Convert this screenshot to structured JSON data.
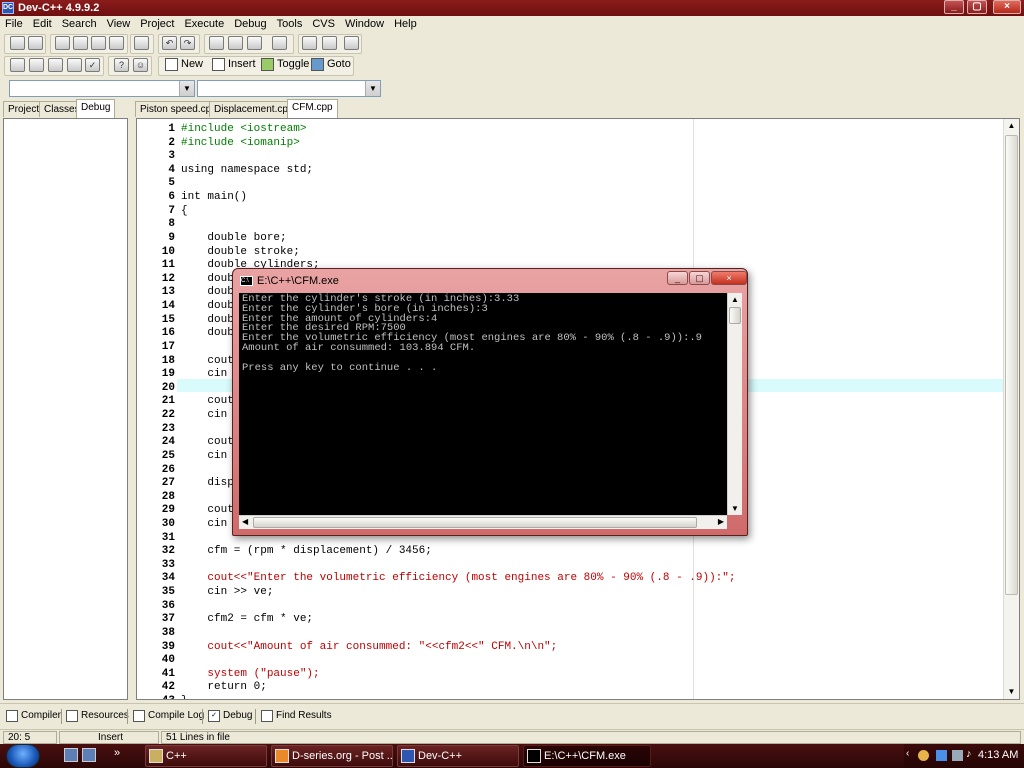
{
  "window": {
    "title": "Dev-C++ 4.9.9.2",
    "app_icon_text": "DC",
    "controls": [
      "_",
      "▢",
      "×"
    ]
  },
  "menubar": {
    "items": [
      "File",
      "Edit",
      "Search",
      "View",
      "Project",
      "Execute",
      "Debug",
      "Tools",
      "CVS",
      "Window",
      "Help"
    ]
  },
  "toolbar2": {
    "new_label": "New",
    "insert_label": "Insert",
    "toggle_label": "Toggle",
    "goto_label": "Goto"
  },
  "left_tabs": [
    "Project",
    "Classes",
    "Debug"
  ],
  "file_tabs": [
    "Piston speed.cpp",
    "Displacement.cpp",
    "CFM.cpp"
  ],
  "active_file_tab": "CFM.cpp",
  "editor": {
    "highlighted_line": "20",
    "lines": [
      {
        "n": "1",
        "text": "#include <iostream>",
        "kind": "pp"
      },
      {
        "n": "2",
        "text": "#include <iomanip>",
        "kind": "pp"
      },
      {
        "n": "3",
        "text": "",
        "kind": "plain"
      },
      {
        "n": "4",
        "text": "using namespace std;",
        "kind": "plain"
      },
      {
        "n": "5",
        "text": "",
        "kind": "plain"
      },
      {
        "n": "6",
        "text": "int main()",
        "kind": "plain"
      },
      {
        "n": "7",
        "text": "{",
        "kind": "plain"
      },
      {
        "n": "8",
        "text": "",
        "kind": "plain"
      },
      {
        "n": "9",
        "text": "    double bore;",
        "kind": "plain"
      },
      {
        "n": "10",
        "text": "    double stroke;",
        "kind": "plain"
      },
      {
        "n": "11",
        "text": "    double cylinders;",
        "kind": "plain"
      },
      {
        "n": "12",
        "text": "    doub",
        "kind": "plain"
      },
      {
        "n": "13",
        "text": "    doub",
        "kind": "plain"
      },
      {
        "n": "14",
        "text": "    doub",
        "kind": "plain"
      },
      {
        "n": "15",
        "text": "    doub",
        "kind": "plain"
      },
      {
        "n": "16",
        "text": "    doub",
        "kind": "plain"
      },
      {
        "n": "17",
        "text": "",
        "kind": "plain"
      },
      {
        "n": "18",
        "text": "    cout",
        "kind": "plain"
      },
      {
        "n": "19",
        "text": "    cin",
        "kind": "plain"
      },
      {
        "n": "20",
        "text": "",
        "kind": "plain"
      },
      {
        "n": "21",
        "text": "    cout",
        "kind": "plain"
      },
      {
        "n": "22",
        "text": "    cin",
        "kind": "plain"
      },
      {
        "n": "23",
        "text": "",
        "kind": "plain"
      },
      {
        "n": "24",
        "text": "    cout",
        "kind": "plain"
      },
      {
        "n": "25",
        "text": "    cin",
        "kind": "plain"
      },
      {
        "n": "26",
        "text": "",
        "kind": "plain"
      },
      {
        "n": "27",
        "text": "    disp",
        "kind": "plain"
      },
      {
        "n": "28",
        "text": "",
        "kind": "plain"
      },
      {
        "n": "29",
        "text": "    cout",
        "kind": "plain"
      },
      {
        "n": "30",
        "text": "    cin",
        "kind": "plain"
      },
      {
        "n": "31",
        "text": "",
        "kind": "plain"
      },
      {
        "n": "32",
        "text": "    cfm = (rpm * displacement) / 3456;",
        "kind": "num"
      },
      {
        "n": "33",
        "text": "",
        "kind": "plain"
      },
      {
        "n": "34",
        "text": "    cout<<\"Enter the volumetric efficiency (most engines are 80% - 90% (.8 - .9)):\";",
        "kind": "str"
      },
      {
        "n": "35",
        "text": "    cin >> ve;",
        "kind": "plain"
      },
      {
        "n": "36",
        "text": "",
        "kind": "plain"
      },
      {
        "n": "37",
        "text": "    cfm2 = cfm * ve;",
        "kind": "plain"
      },
      {
        "n": "38",
        "text": "",
        "kind": "plain"
      },
      {
        "n": "39",
        "text": "    cout<<\"Amount of air consummed: \"<<cfm2<<\" CFM.\\n\\n\";",
        "kind": "str"
      },
      {
        "n": "40",
        "text": "",
        "kind": "plain"
      },
      {
        "n": "41",
        "text": "    system (\"pause\");",
        "kind": "str"
      },
      {
        "n": "42",
        "text": "    return 0;",
        "kind": "num"
      },
      {
        "n": "43",
        "text": "}",
        "kind": "plain"
      }
    ]
  },
  "console": {
    "title": "E:\\C++\\CFM.exe",
    "icon_text": "C:\\",
    "output": "Enter the cylinder's stroke (in inches):3.33\nEnter the cylinder's bore (in inches):3\nEnter the amount of cylinders:4\nEnter the desired RPM:7500\nEnter the volumetric efficiency (most engines are 80% - 90% (.8 - .9)):.9\nAmount of air consummed: 103.894 CFM.\n\nPress any key to continue . . ."
  },
  "bottom_tabs": [
    "Compiler",
    "Resources",
    "Compile Log",
    "Debug",
    "Find Results"
  ],
  "status": {
    "position": "20: 5",
    "mode": "Insert",
    "lines_info": "51 Lines in file"
  },
  "taskbar": {
    "more": "»",
    "buttons": [
      {
        "label": "C++",
        "icon": "folder-icon"
      },
      {
        "label": "D-series.org - Post ...",
        "icon": "firefox-icon"
      },
      {
        "label": "Dev-C++",
        "icon": "devcpp-icon"
      },
      {
        "label": "E:\\C++\\CFM.exe",
        "icon": "console-icon"
      }
    ],
    "time": "4:13 AM"
  }
}
